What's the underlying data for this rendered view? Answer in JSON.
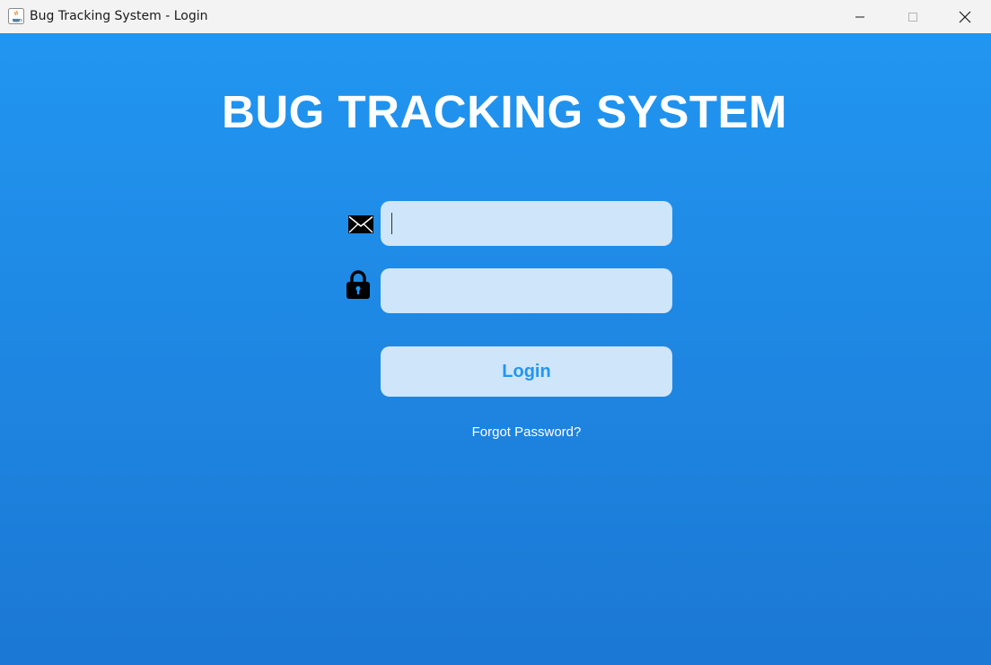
{
  "window": {
    "title": "Bug Tracking System - Login",
    "controls": {
      "minimize_icon": "minimize-icon",
      "maximize_icon": "maximize-icon",
      "close_icon": "close-icon"
    }
  },
  "login": {
    "heading": "BUG TRACKING SYSTEM",
    "email": {
      "icon": "envelope-icon",
      "value": "",
      "placeholder": ""
    },
    "password": {
      "icon": "lock-icon",
      "value": "",
      "placeholder": ""
    },
    "login_button_label": "Login",
    "forgot_password_label": "Forgot Password?"
  },
  "colors": {
    "background_top": "#2196f1",
    "background_bottom": "#1b78d4",
    "field_background": "#cfe5f9",
    "button_text": "#2196f1",
    "heading_text": "#ffffff",
    "titlebar": "#f3f3f3"
  }
}
